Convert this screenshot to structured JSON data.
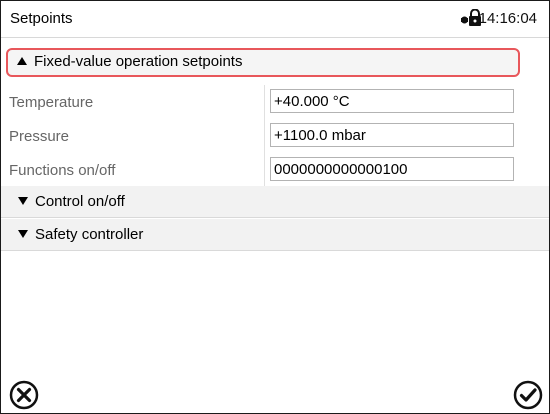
{
  "titlebar": {
    "title": "Setpoints",
    "time": "14:16:04",
    "status_icon": "lock-icon"
  },
  "sections": [
    {
      "label": "Fixed-value operation setpoints",
      "expanded": true
    },
    {
      "label": "Control on/off",
      "expanded": false
    },
    {
      "label": "Safety controller",
      "expanded": false
    }
  ],
  "rows": [
    {
      "label": "Temperature",
      "value": "+40.000 °C"
    },
    {
      "label": "Pressure",
      "value": "+1100.0 mbar"
    },
    {
      "label": "Functions on/off",
      "value": "0000000000000100"
    }
  ],
  "buttons": {
    "cancel_icon": "close-circle-icon",
    "confirm_icon": "check-circle-icon"
  },
  "colors": {
    "highlight": "#e8575b",
    "section_bg": "#f2f2f2"
  }
}
